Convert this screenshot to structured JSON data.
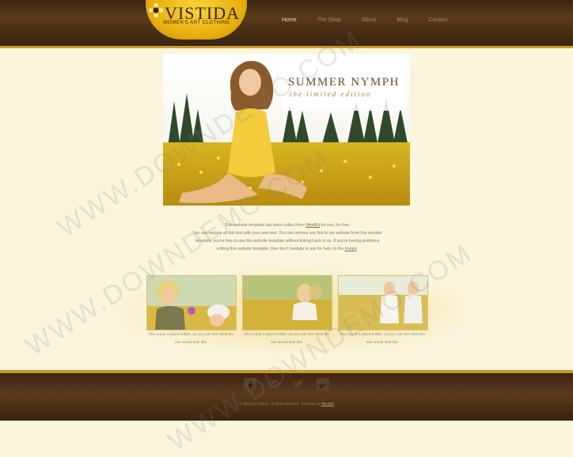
{
  "header": {
    "logo_name": "VISTIDA",
    "logo_tagline": "WOMEN'S ART CLOTHING",
    "nav": [
      "Home",
      "The Shop",
      "About",
      "Blog",
      "Contact"
    ],
    "active_nav": "Home"
  },
  "hero": {
    "title": "SUMMER NYMPH",
    "subtitle": "the limited edition"
  },
  "intro": {
    "line1_before": "This website template has been collect from ",
    "line1_link": "Win4Kit",
    "line1_after": " for you, for free.",
    "line2": "You can replace all this text with your own text. You can remove any link to our website from this website",
    "line3": "template, you're free to use this website template without linking back to us. If you're having problems",
    "line4_before": "editing this website template, then don't hesitate to ask for help on the ",
    "line4_link": "Forum",
    "line4_after": "."
  },
  "thumbs": [
    {
      "caption": "This is just a place holder, so you can see what the site would look like"
    },
    {
      "caption": "This is just a place holder, so you can see what the site would look like"
    },
    {
      "caption": "This is just a place holder, so you can see what the site would look like"
    }
  ],
  "footer": {
    "social_icons": [
      "facebook-icon",
      "mail-icon",
      "twitter-icon",
      "googleplus-icon"
    ],
    "copyright_text": "© 2012 by Vistida. All rights reserved. Template by",
    "copyright_link": "Win4Kit"
  },
  "watermark": "WWW.DOWNDEMO.COM",
  "colors": {
    "header_brown": "#3b2410",
    "gold": "#c89a2a",
    "page_bg": "#fbf5dd"
  }
}
